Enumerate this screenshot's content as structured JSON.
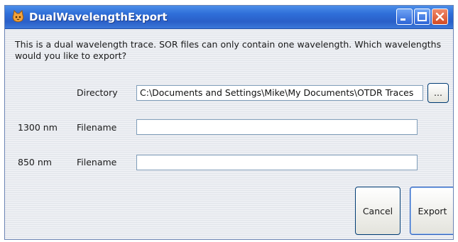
{
  "window": {
    "title": "DualWavelengthExport",
    "message": "This is a dual wavelength trace. SOR files can only contain one wavelength.  Which wavelengths would you like to export?"
  },
  "directory": {
    "label": "Directory",
    "value": "C:\\Documents and Settings\\Mike\\My Documents\\OTDR Traces",
    "browse_label": "..."
  },
  "wavelengths": [
    {
      "label": "1300 nm",
      "field_label": "Filename",
      "value": ""
    },
    {
      "label": "850 nm",
      "field_label": "Filename",
      "value": ""
    }
  ],
  "buttons": {
    "cancel": "Cancel",
    "export": "Export"
  },
  "colors": {
    "titlebar": "#2f6fd9",
    "close_button": "#d34a24",
    "panel": "#eef0f4"
  }
}
